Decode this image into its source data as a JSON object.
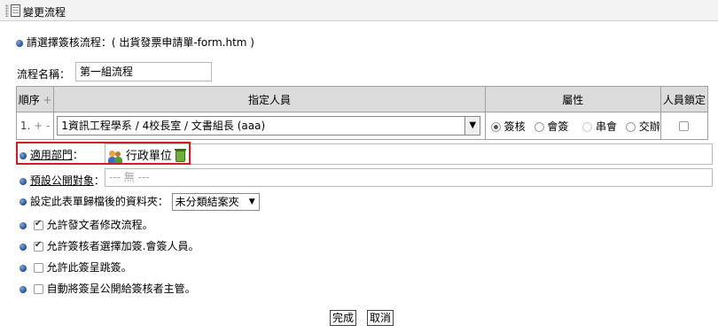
{
  "window": {
    "title": "變更流程"
  },
  "selected_flow": {
    "label": "請選擇簽核流程：",
    "value": "( 出貨發票申請單-form.htm )"
  },
  "flow_name": {
    "label": "流程名稱：",
    "value": "第一組流程"
  },
  "table": {
    "headers": {
      "seq": "順序",
      "seq_add": "+",
      "assignee": "指定人員",
      "attribute": "屬性",
      "lock": "人員鎖定"
    },
    "rows": [
      {
        "seq": "1.",
        "plus": "+",
        "minus": "-",
        "assignee": "1資訊工程學系 / 4校長室 / 文書組長 (aaa)",
        "options": [
          "簽核",
          "會簽",
          "串會",
          "交辦"
        ],
        "selected_option": "簽核",
        "locked": false
      }
    ]
  },
  "dept": {
    "label": "適用部門",
    "colon": "：",
    "value": "行政單位"
  },
  "public_target": {
    "label": "預設公開對象",
    "colon": "：",
    "placeholder": "--- 無 ---"
  },
  "archive": {
    "label": "設定此表單歸檔後的資料夾：",
    "value": "未分類結案夾"
  },
  "options": [
    {
      "label": "允許發文者修改流程。",
      "checked": true
    },
    {
      "label": "允許簽核者選擇加簽.會簽人員。",
      "checked": true
    },
    {
      "label": "允許此簽呈跳簽。",
      "checked": false
    },
    {
      "label": "自動將簽呈公開給簽核者主管。",
      "checked": false
    }
  ],
  "buttons": {
    "finish": "完成",
    "cancel": "取消"
  }
}
